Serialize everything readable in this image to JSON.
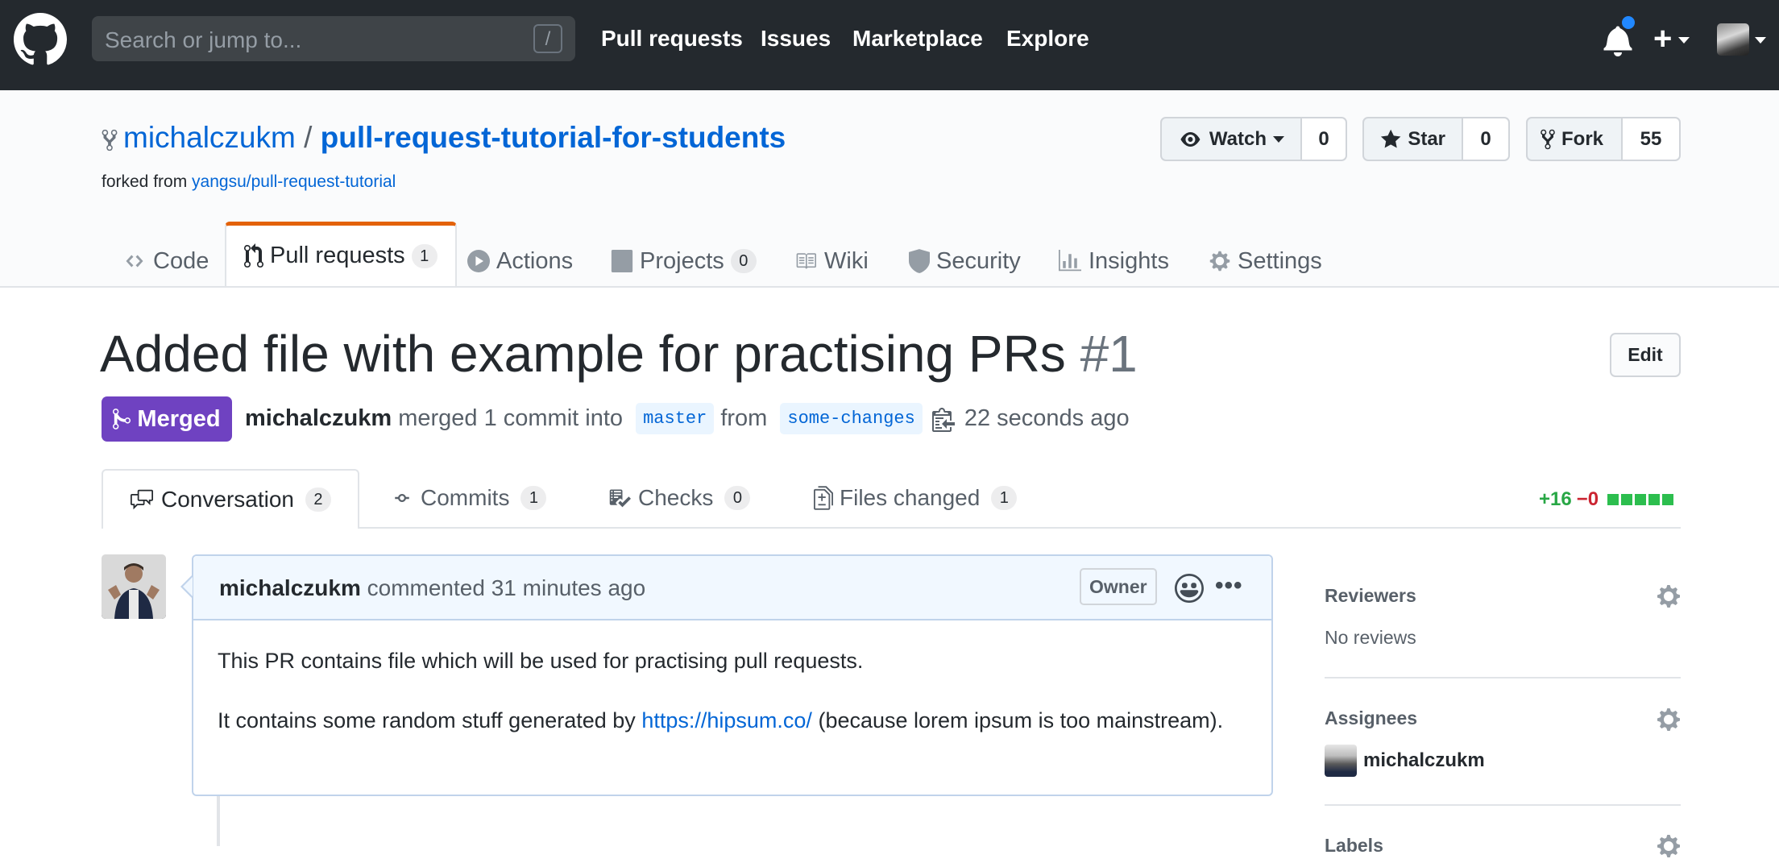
{
  "header": {
    "search_placeholder": "Search or jump to...",
    "search_shortcut": "/",
    "nav": [
      "Pull requests",
      "Issues",
      "Marketplace",
      "Explore"
    ]
  },
  "repo": {
    "owner": "michalczukm",
    "separator": "/",
    "name": "pull-request-tutorial-for-students",
    "forked_prefix": "forked from",
    "forked_from": "yangsu/pull-request-tutorial",
    "watch": {
      "label": "Watch",
      "count": "0"
    },
    "star": {
      "label": "Star",
      "count": "0"
    },
    "fork": {
      "label": "Fork",
      "count": "55"
    }
  },
  "repo_tabs": [
    {
      "label": "Code",
      "icon": "code-icon"
    },
    {
      "label": "Pull requests",
      "icon": "git-pull-request-icon",
      "count": "1",
      "selected": true
    },
    {
      "label": "Actions",
      "icon": "play-icon"
    },
    {
      "label": "Projects",
      "icon": "project-icon",
      "count": "0"
    },
    {
      "label": "Wiki",
      "icon": "book-icon"
    },
    {
      "label": "Security",
      "icon": "shield-icon"
    },
    {
      "label": "Insights",
      "icon": "graph-icon"
    },
    {
      "label": "Settings",
      "icon": "gear-icon"
    }
  ],
  "pr": {
    "title": "Added file with example for practising PRs",
    "number": "#1",
    "edit_label": "Edit",
    "state": "Merged",
    "author": "michalczukm",
    "merged_text": "merged 1 commit into",
    "base_branch": "master",
    "from_text": "from",
    "head_branch": "some-changes",
    "time": "22 seconds ago"
  },
  "pr_tabs": [
    {
      "label": "Conversation",
      "count": "2",
      "icon": "comment-discussion-icon",
      "selected": true
    },
    {
      "label": "Commits",
      "count": "1",
      "icon": "git-commit-icon"
    },
    {
      "label": "Checks",
      "count": "0",
      "icon": "checklist-icon"
    },
    {
      "label": "Files changed",
      "count": "1",
      "icon": "file-diff-icon"
    }
  ],
  "diffstat": {
    "additions": "+16",
    "deletions": "−0",
    "blocks": 5
  },
  "comment": {
    "author": "michalczukm",
    "action": "commented",
    "time": "31 minutes ago",
    "badge": "Owner",
    "paragraph1": "This PR contains file which will be used for practising pull requests.",
    "paragraph2_before": "It contains some random stuff generated by",
    "paragraph2_link": "https://hipsum.co/",
    "paragraph2_after": "(because lorem ipsum is too mainstream)."
  },
  "sidebar": {
    "reviewers": {
      "heading": "Reviewers",
      "value": "No reviews"
    },
    "assignees": {
      "heading": "Assignees",
      "user": "michalczukm"
    },
    "labels": {
      "heading": "Labels"
    }
  },
  "colors": {
    "header_bg": "#24292e",
    "link": "#0366d6",
    "merged": "#6f42c1",
    "active_tab_border": "#e36209",
    "additions": "#28a745",
    "deletions": "#cb2431"
  }
}
